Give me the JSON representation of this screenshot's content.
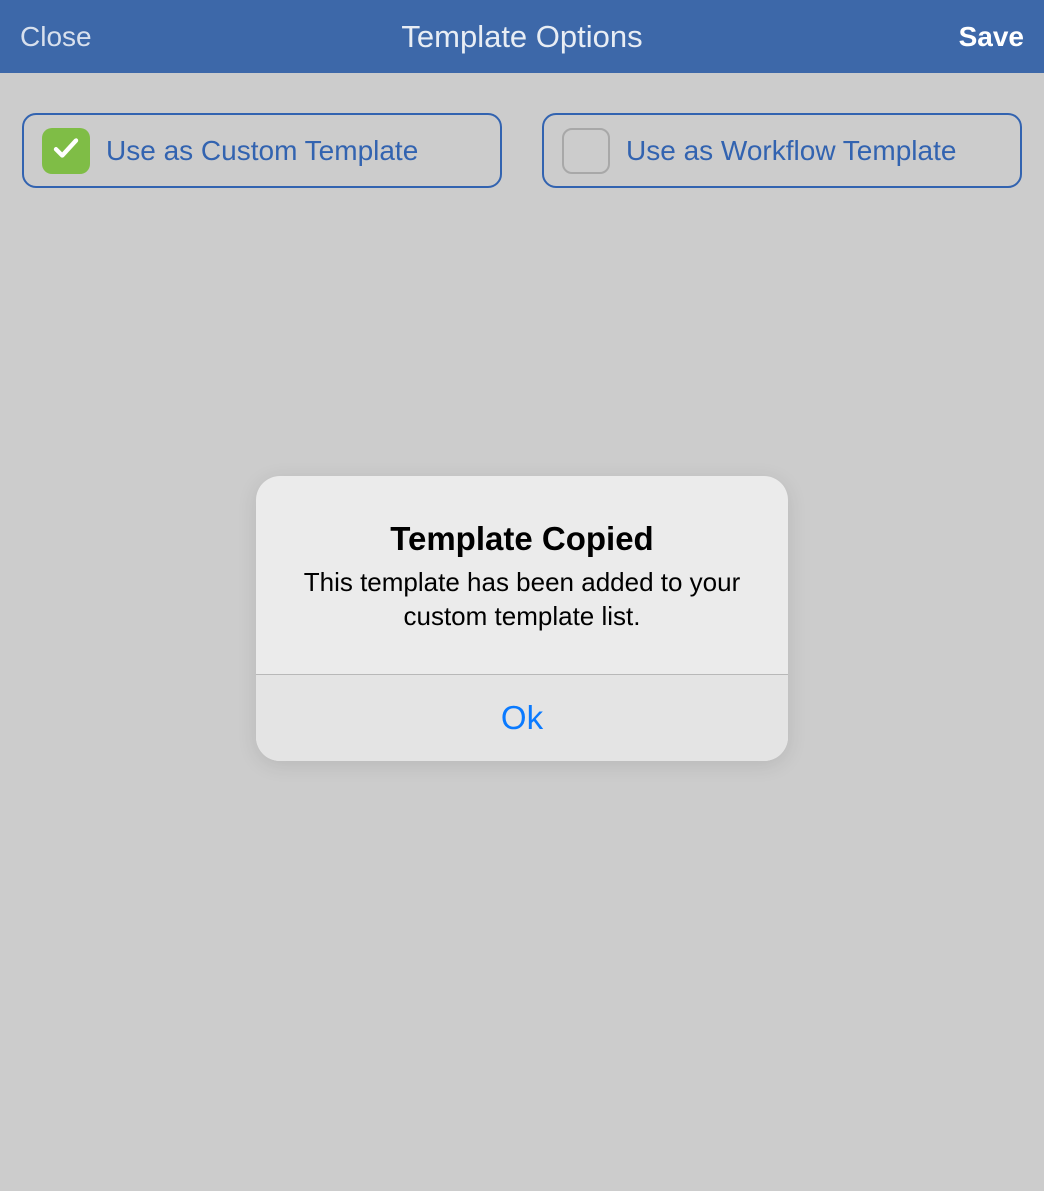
{
  "header": {
    "close_label": "Close",
    "title": "Template Options",
    "save_label": "Save"
  },
  "options": {
    "custom": {
      "label": "Use as Custom Template",
      "checked": true
    },
    "workflow": {
      "label": "Use as Workflow Template",
      "checked": false
    }
  },
  "modal": {
    "title": "Template Copied",
    "message": "This template has been added to your custom template list.",
    "ok_label": "Ok"
  }
}
